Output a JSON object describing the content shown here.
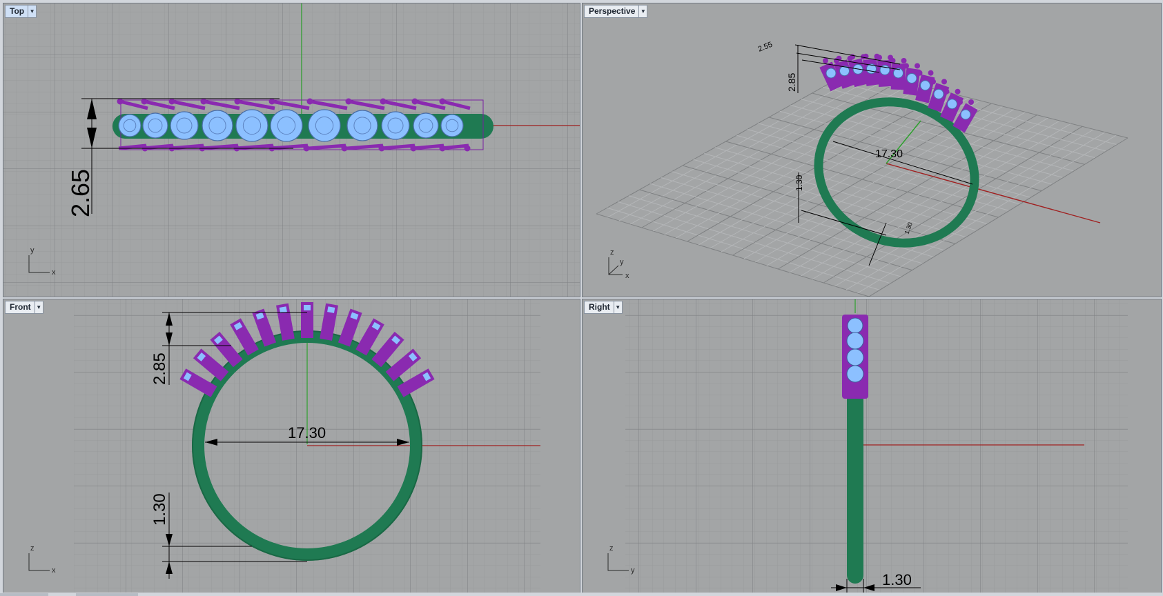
{
  "viewports": {
    "top": {
      "title": "Top"
    },
    "perspective": {
      "title": "Perspective"
    },
    "front": {
      "title": "Front"
    },
    "right": {
      "title": "Right"
    }
  },
  "tab_menu_icon": "dropdown-arrow-icon",
  "dimensions": {
    "top_height": "2.65",
    "perspective_width": "2.55",
    "perspective_height": "2.85",
    "perspective_diameter": "17.30",
    "perspective_band": "1.30",
    "perspective_small": "1.30",
    "front_height": "2.85",
    "front_diameter": "17.30",
    "front_band": "1.30",
    "right_band": "1.30"
  },
  "axes": {
    "top": {
      "v": "y",
      "h": "x"
    },
    "persp": {
      "z": "z",
      "y": "y",
      "x": "x"
    },
    "front": {
      "v": "z",
      "h": "x"
    },
    "right": {
      "v": "z",
      "h": "y"
    }
  },
  "colors": {
    "viewport_bg": "#a3a5a6",
    "grid_minor": "#989a9c",
    "grid_major": "#7e8082",
    "x_axis": "#a02020",
    "y_axis": "#2ca02c",
    "band": "#1f7a52",
    "prongs": "#8a2ab0",
    "stones": "#8cc0ff",
    "active_tab": "#cfe0f6"
  }
}
